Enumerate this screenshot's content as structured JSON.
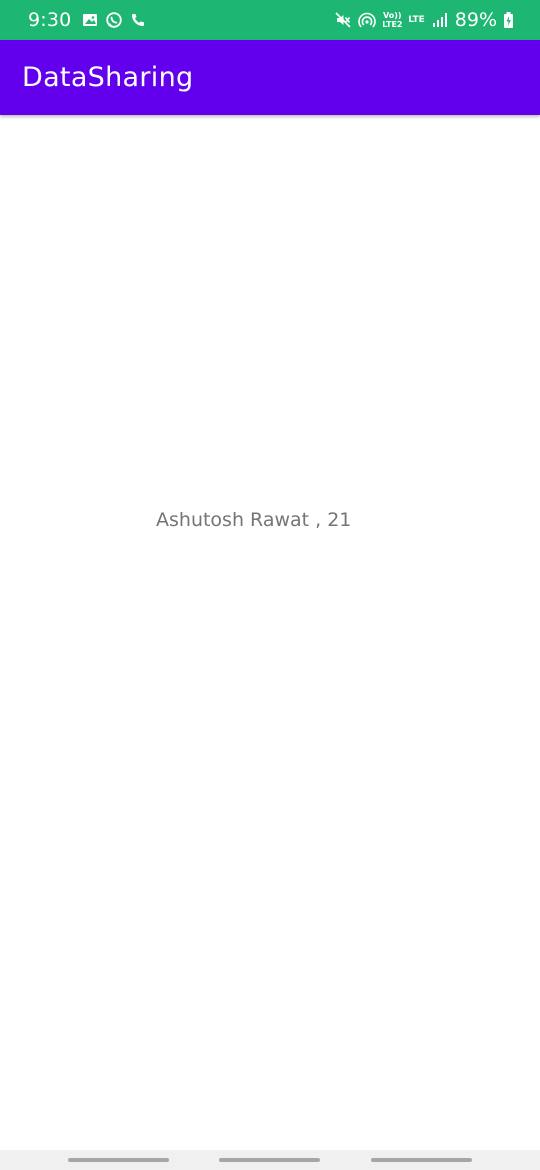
{
  "status_bar": {
    "time": "9:30",
    "battery_percent": "89%",
    "volte_label": "Vo)) LTE2",
    "lte_label": "LTE",
    "background_color": "#1DB672",
    "icons_left": [
      "gallery-icon",
      "whatsapp-icon",
      "phone-icon"
    ],
    "icons_right": [
      "mute-icon",
      "hotspot-icon",
      "volte-icon",
      "lte-icon",
      "signal-icon",
      "battery-charging-icon"
    ]
  },
  "app_bar": {
    "title": "DataSharing",
    "background_color": "#6200EE"
  },
  "main": {
    "info_text": "Ashutosh Rawat , 21"
  },
  "nav_bar": {
    "pills": 3
  }
}
